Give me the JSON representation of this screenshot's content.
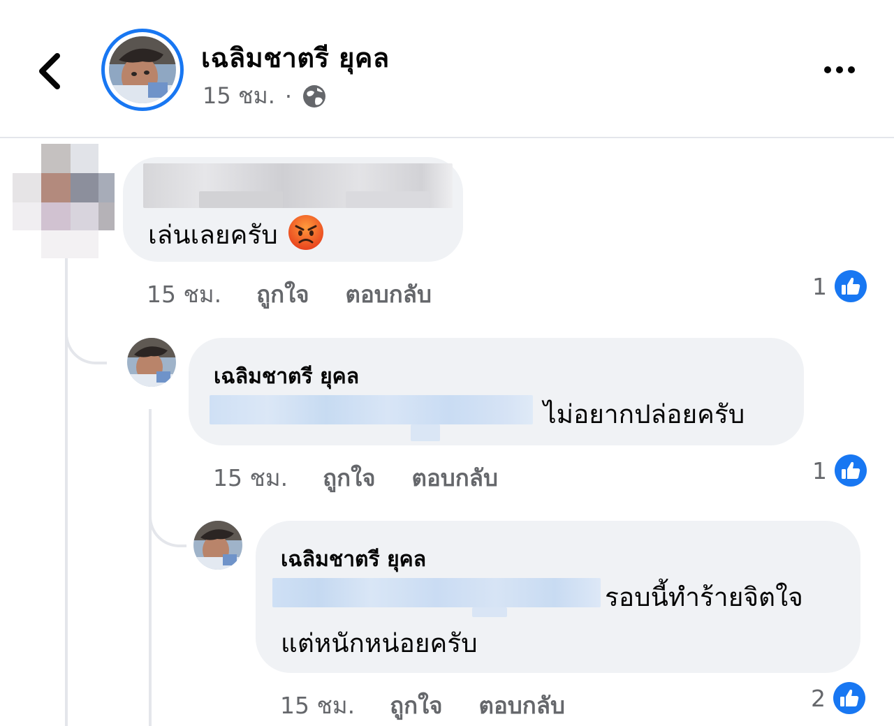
{
  "header": {
    "author_name": "เฉลิมชาตรี ยุคล",
    "time": "15 ชม.",
    "separator": "·",
    "privacy_icon": "globe-icon",
    "back_icon": "chevron-left-icon",
    "more_icon": "more-horizontal-icon"
  },
  "comments": [
    {
      "author": "",
      "text": "เล่นเลยครับ",
      "emoji": "angry-face-emoji",
      "time": "15 ชม.",
      "like_label": "ถูกใจ",
      "reply_label": "ตอบกลับ",
      "likes": "1"
    },
    {
      "author": "เฉลิมชาตรี ยุคล",
      "text": "ไม่อยากปล่อยครับ",
      "time": "15 ชม.",
      "like_label": "ถูกใจ",
      "reply_label": "ตอบกลับ",
      "likes": "1"
    },
    {
      "author": "เฉลิมชาตรี ยุคล",
      "text_line1": "รอบนี้ทำร้ายจิตใจ",
      "text_line2": "แต่หนักหน่อยครับ",
      "time": "15 ชม.",
      "like_label": "ถูกใจ",
      "reply_label": "ตอบกลับ",
      "likes": "2"
    }
  ],
  "colors": {
    "accent": "#1877f2",
    "bubble": "#f0f2f5",
    "secondary_text": "#65676b",
    "redaction_blue": "#cfe0f5"
  }
}
